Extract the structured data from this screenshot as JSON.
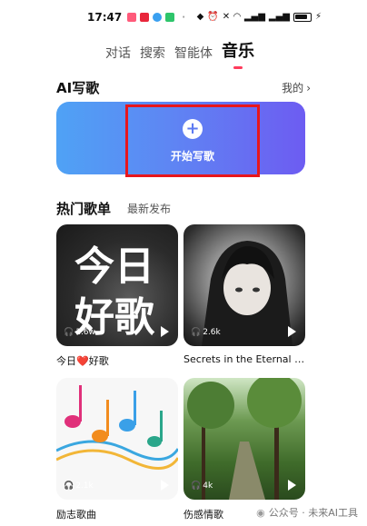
{
  "status_bar": {
    "time": "17:47",
    "battery_text": ""
  },
  "tabs": [
    {
      "label": "对话",
      "active": false
    },
    {
      "label": "搜索",
      "active": false
    },
    {
      "label": "智能体",
      "active": false
    },
    {
      "label": "音乐",
      "active": true
    }
  ],
  "ai_write": {
    "title": "AI写歌",
    "mine_label": "我的",
    "start_label": "开始写歌",
    "gradient_colors": [
      "#4fa2f5",
      "#6d5cf2"
    ]
  },
  "hot_songs": {
    "title": "热门歌单",
    "subtab": "最新发布",
    "cards": [
      {
        "cover_text_line1": "今日",
        "cover_text_line2": "好歌",
        "play_count": "1.6w",
        "title": "今日❤️好歌"
      },
      {
        "play_count": "2.6k",
        "title": "Secrets in the Eternal Sh..."
      },
      {
        "play_count": "2.1k",
        "title": "励志歌曲"
      },
      {
        "play_count": "4k",
        "title": "伤感情歌"
      }
    ]
  },
  "watermark": "公众号 · 未来AI工具",
  "colors": {
    "accent": "#ff3b5c",
    "highlight_border": "#e8161c"
  }
}
